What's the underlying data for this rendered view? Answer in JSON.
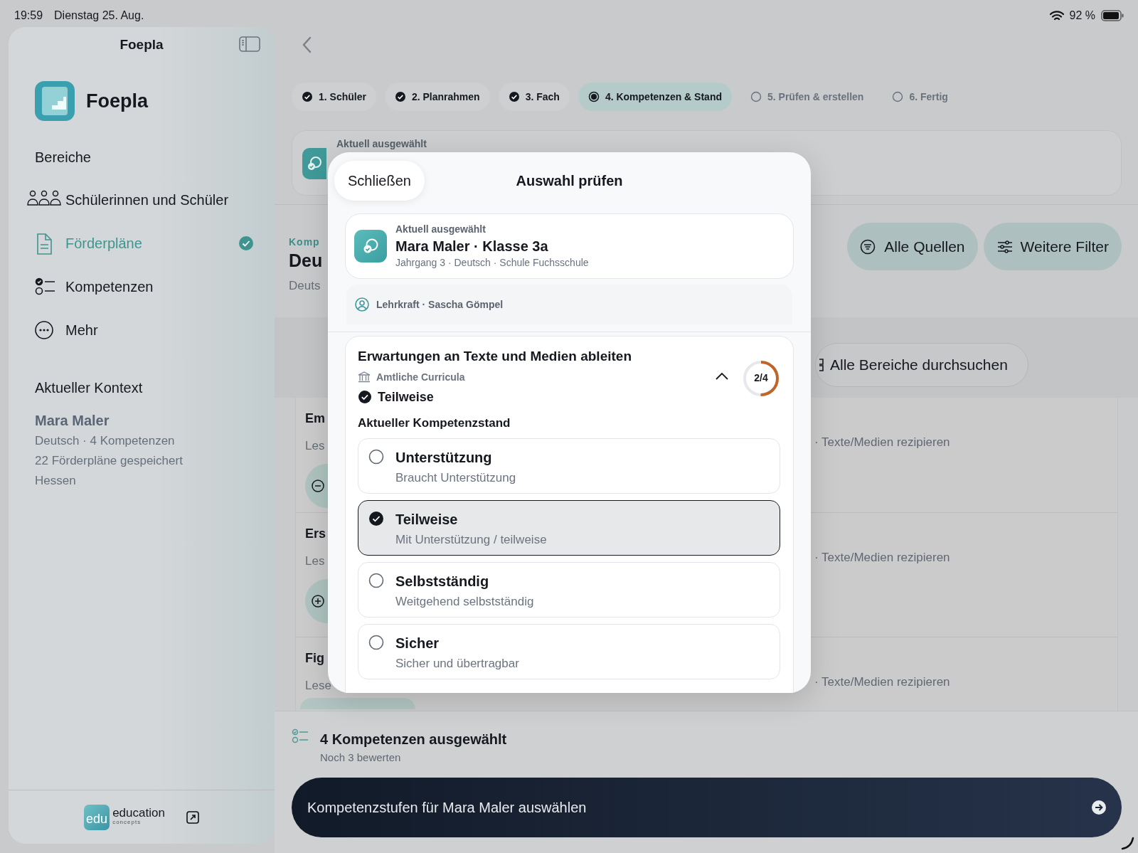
{
  "status_bar": {
    "time": "19:59",
    "date": "Dienstag 25. Aug.",
    "battery": "92 %"
  },
  "sidebar": {
    "title": "Foepla",
    "app_name": "Foepla",
    "section_title": "Bereiche",
    "items": [
      {
        "label": "Schülerinnen und Schüler",
        "selected": false
      },
      {
        "label": "Förderpläne",
        "selected": true
      },
      {
        "label": "Kompetenzen",
        "selected": false
      },
      {
        "label": "Mehr",
        "selected": false
      }
    ],
    "context_title": "Aktueller Kontext",
    "context_name": "Mara Maler",
    "context_lines": [
      "Deutsch · 4 Kompetenzen",
      "22 Förderpläne gespeichert",
      "Hessen"
    ],
    "footer_logo": {
      "mark": "edu",
      "name": "education",
      "tagline": "concepts"
    }
  },
  "steps": [
    {
      "label": "1. Schüler",
      "completed": true,
      "selected": false
    },
    {
      "label": "2. Planrahmen",
      "completed": true,
      "selected": false
    },
    {
      "label": "3. Fach",
      "completed": true,
      "selected": false
    },
    {
      "label": "4. Kompetenzen & Stand",
      "completed": false,
      "selected": true
    },
    {
      "label": "5. Prüfen & erstellen",
      "completed": false,
      "selected": false
    },
    {
      "label": "6. Fertig",
      "completed": false,
      "selected": false
    }
  ],
  "selection_card": {
    "label": "Aktuell ausgewählt"
  },
  "section": {
    "eyebrow": "Komp",
    "title": "Deu",
    "subtitle": "Deuts",
    "filters": [
      "Alle Quellen",
      "Weitere Filter"
    ]
  },
  "search_button": "Alle Bereiche durchsuchen",
  "rows": [
    {
      "title": "Em",
      "subtitle": "Les",
      "meta": "· Texte/Medien rezipieren",
      "added": true
    },
    {
      "title": "Ers",
      "subtitle": "Les",
      "meta": "· Texte/Medien rezipieren",
      "added": false
    },
    {
      "title": "Fig",
      "subtitle": "Lese",
      "meta": "· Texte/Medien rezipieren"
    }
  ],
  "summary": {
    "title": "4 Kompetenzen ausgewählt",
    "subtitle": "Noch 3 bewerten"
  },
  "primary_button": "Kompetenzstufen für Mara Maler auswählen",
  "modal": {
    "close": "Schließen",
    "title": "Auswahl prüfen",
    "student": {
      "label": "Aktuell ausgewählt",
      "name": "Mara Maler · Klasse 3a",
      "details": "Jahrgang 3 · Deutsch · Schule Fuchsschule"
    },
    "teacher": "Lehrkraft · Sascha Gömpel",
    "competence": {
      "title": "Erwartungen an Texte und Medien ableiten",
      "source": "Amtliche Curricula",
      "status": "Teilweise",
      "expanded": true,
      "progress": {
        "text": "2/4",
        "level": 0.5
      },
      "levels_title": "Aktueller Kompetenzstand",
      "options": [
        {
          "title": "Unterstützung",
          "subtitle": "Braucht Unterstützung",
          "selected": false
        },
        {
          "title": "Teilweise",
          "subtitle": "Mit Unterstützung / teilweise",
          "selected": true
        },
        {
          "title": "Selbstständig",
          "subtitle": "Weitgehend selbstständig",
          "selected": false
        },
        {
          "title": "Sicher",
          "subtitle": "Sicher und übertragbar",
          "selected": false
        }
      ]
    }
  }
}
